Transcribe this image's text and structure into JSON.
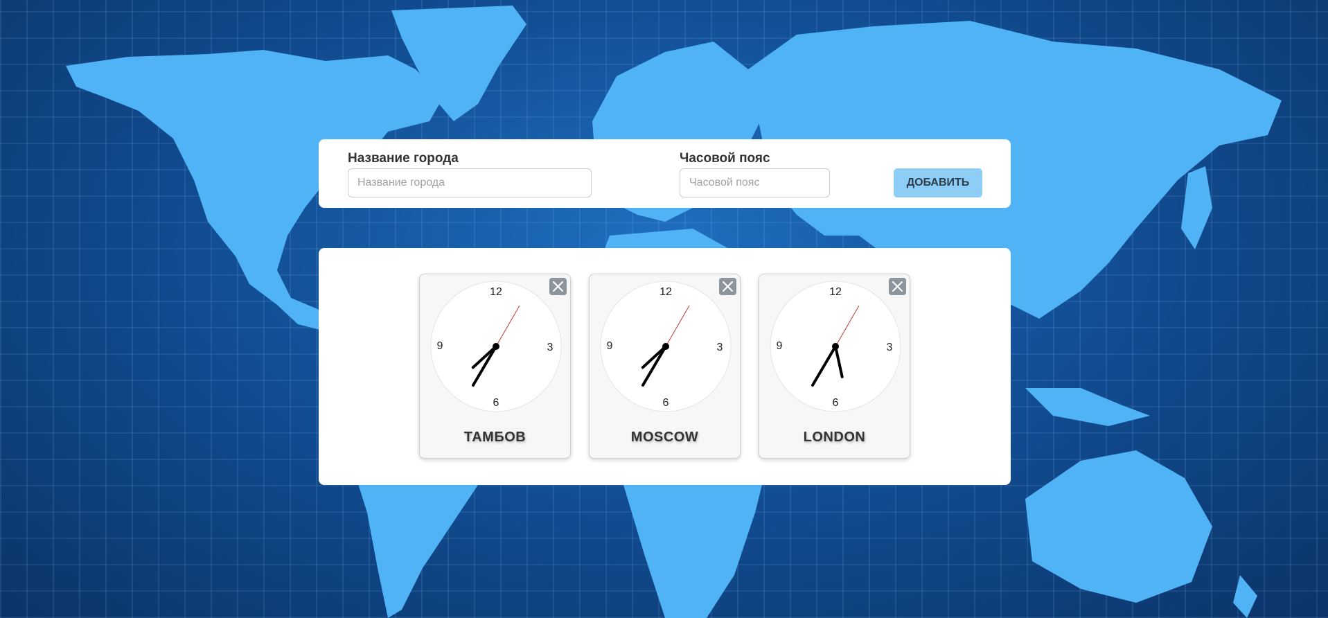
{
  "form": {
    "city_label": "Название города",
    "city_placeholder": "Название города",
    "city_value": "",
    "timezone_label": "Часовой пояс",
    "timezone_placeholder": "Часовой пояс",
    "timezone_value": "",
    "add_button_label": "ДОБАВИТЬ"
  },
  "clock_numerals": [
    "12",
    "3",
    "6",
    "9"
  ],
  "clocks": [
    {
      "city": "ТАМБОВ",
      "time": {
        "hours": 7,
        "minutes": 35,
        "seconds": 5
      }
    },
    {
      "city": "MOSCOW",
      "time": {
        "hours": 7,
        "minutes": 35,
        "seconds": 5
      }
    },
    {
      "city": "LONDON",
      "time": {
        "hours": 5,
        "minutes": 35,
        "seconds": 5
      }
    }
  ],
  "icons": {
    "close": "close-icon",
    "background": "world-map"
  },
  "colors": {
    "background": "#124f95",
    "continents": "#4fb3f6",
    "add_button": "#8ecdf5",
    "close_button": "#8c959c",
    "second_hand": "#c0392b",
    "hands": "#000000"
  }
}
